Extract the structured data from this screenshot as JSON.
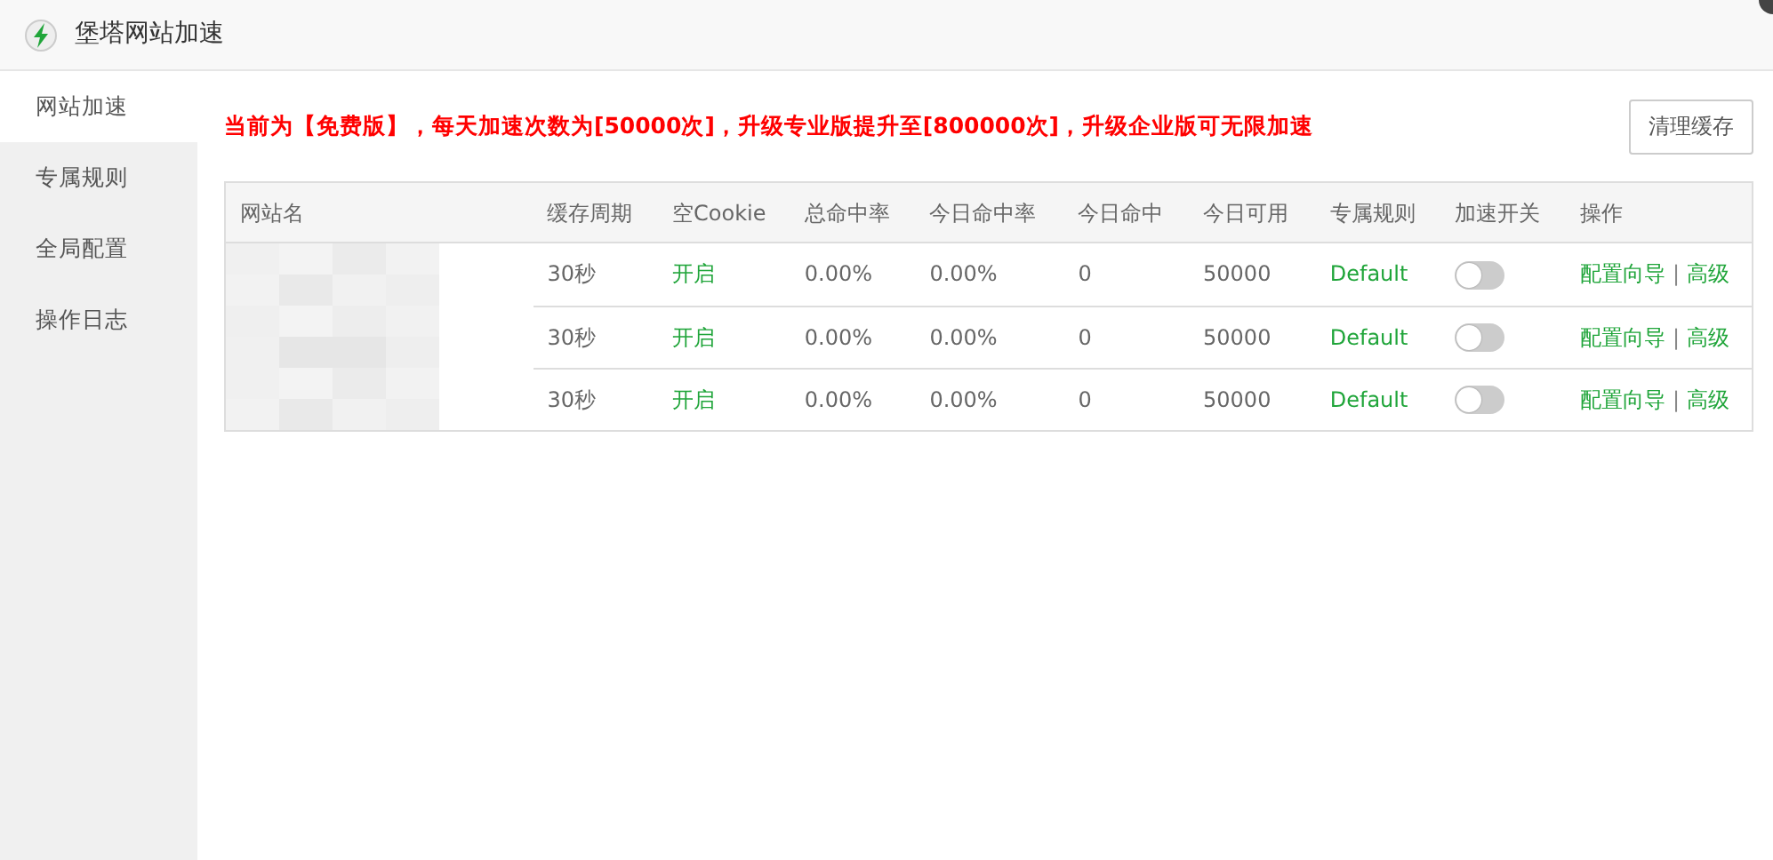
{
  "window": {
    "title": "堡塔网站加速"
  },
  "sidebar": {
    "items": [
      {
        "label": "网站加速",
        "selected": true
      },
      {
        "label": "专属规则",
        "selected": false
      },
      {
        "label": "全局配置",
        "selected": false
      },
      {
        "label": "操作日志",
        "selected": false
      }
    ]
  },
  "notice": "当前为【免费版】，每天加速次数为[50000次]，升级专业版提升至[800000次]，升级企业版可无限加速",
  "clear_cache_button": "清理缓存",
  "table": {
    "columns": [
      "网站名",
      "缓存周期",
      "空Cookie",
      "总命中率",
      "今日命中率",
      "今日命中",
      "今日可用",
      "专属规则",
      "加速开关",
      "操作"
    ],
    "rows": [
      {
        "cache_period": "30秒",
        "empty_cookie": "开启",
        "total_hit_rate": "0.00%",
        "today_hit_rate": "0.00%",
        "today_hits": "0",
        "today_available": "50000",
        "rule": "Default",
        "on": false,
        "actions": [
          "配置向导",
          "高级"
        ],
        "separator": "|"
      },
      {
        "cache_period": "30秒",
        "empty_cookie": "开启",
        "total_hit_rate": "0.00%",
        "today_hit_rate": "0.00%",
        "today_hits": "0",
        "today_available": "50000",
        "rule": "Default",
        "on": false,
        "actions": [
          "配置向导",
          "高级"
        ],
        "separator": "|"
      },
      {
        "cache_period": "30秒",
        "empty_cookie": "开启",
        "total_hit_rate": "0.00%",
        "today_hit_rate": "0.00%",
        "today_hits": "0",
        "today_available": "50000",
        "rule": "Default",
        "on": false,
        "actions": [
          "配置向导",
          "高级"
        ],
        "separator": "|"
      }
    ]
  }
}
